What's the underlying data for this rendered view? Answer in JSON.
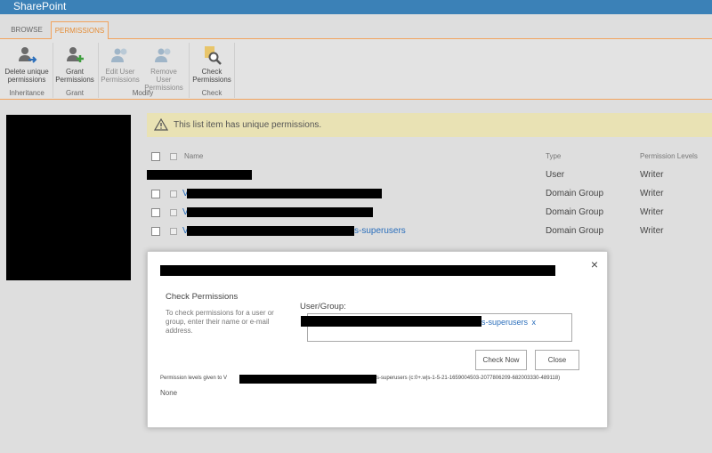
{
  "suite": {
    "title": "SharePoint"
  },
  "ribbon": {
    "tabs": [
      {
        "label": "BROWSE",
        "active": false
      },
      {
        "label": "PERMISSIONS",
        "active": true
      }
    ],
    "buttons": {
      "delete_unique": "Delete unique permissions",
      "grant": "Grant Permissions",
      "edit_user": "Edit User Permissions",
      "remove_user": "Remove User Permissions",
      "check": "Check Permissions"
    },
    "groups": {
      "inheritance": "Inheritance",
      "grant": "Grant",
      "modify": "Modify",
      "check": "Check"
    }
  },
  "warning": {
    "text": "This list item has unique permissions."
  },
  "list": {
    "headers": {
      "name": "Name",
      "type": "Type",
      "level": "Permission Levels"
    },
    "rows": [
      {
        "name_visible": "",
        "type": "User",
        "level": "Writer"
      },
      {
        "name_visible": "V",
        "type": "Domain Group",
        "level": "Writer"
      },
      {
        "name_visible": "V",
        "type": "Domain Group",
        "level": "Writer"
      },
      {
        "name_visible": "V",
        "name_suffix": "s-superusers",
        "type": "Domain Group",
        "level": "Writer"
      }
    ]
  },
  "dialog": {
    "close": "×",
    "section_title": "Check Permissions",
    "description": "To check permissions for a user or group, enter their name or e-mail address.",
    "user_group_label": "User/Group:",
    "chip_suffix": "s-superusers",
    "chip_remove": "x",
    "check_now": "Check Now",
    "close_button": "Close",
    "result_prefix": "Permission levels given to V",
    "result_suffix": "s-superusers (c:0+.w|s-1-5-21-1659004503-2077806209-682003330-489118)",
    "result_value": "None"
  },
  "colors": {
    "suite_bar": "#3b81b7",
    "accent": "#e58e38",
    "link": "#2a6ebb",
    "warning_bg": "#e9e2b4"
  }
}
